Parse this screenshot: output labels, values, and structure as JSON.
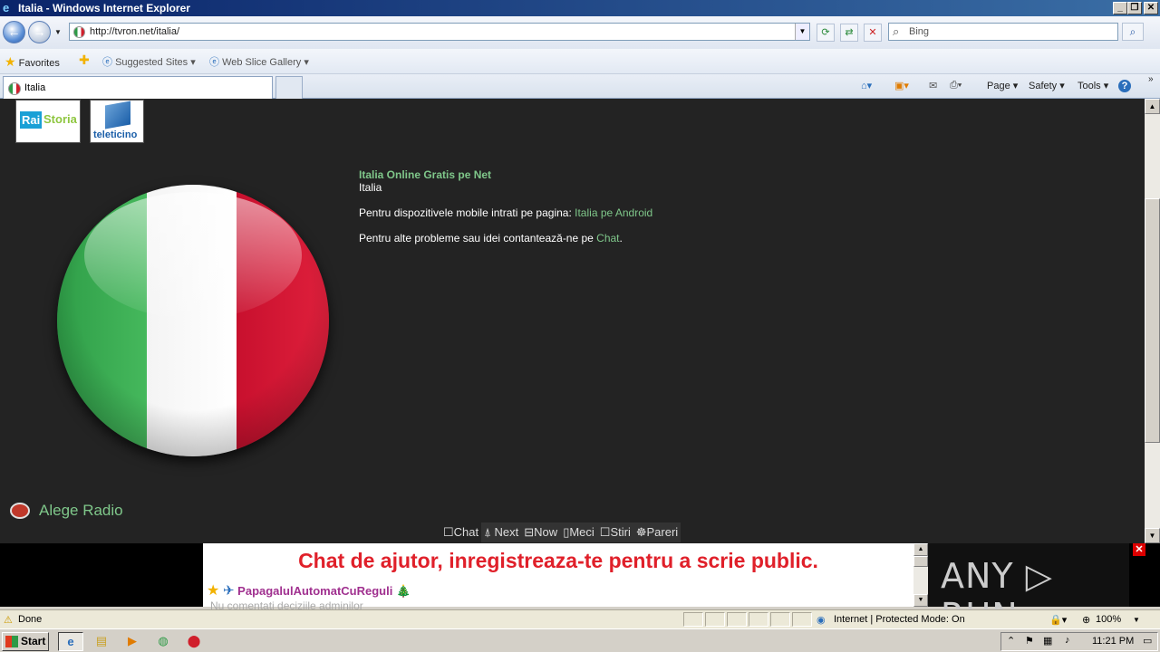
{
  "window": {
    "title": "Italia - Windows Internet Explorer",
    "minimize_label": "_",
    "restore_label": "❐",
    "close_label": "✕"
  },
  "addressbar": {
    "url": "http://tvron.net/italia/",
    "search_placeholder": "Bing"
  },
  "favorites": {
    "favorites_label": "Favorites",
    "suggested_sites": "Suggested Sites ▾",
    "web_slice_gallery": "Web Slice Gallery ▾"
  },
  "tabs": [
    {
      "label": "Italia"
    }
  ],
  "commandbar": {
    "page": "Page ▾",
    "safety": "Safety ▾",
    "tools": "Tools ▾",
    "help": "?"
  },
  "page": {
    "thumbnails": [
      {
        "label_a": "Rai",
        "label_b": "Storia"
      },
      {
        "label": "teleticino"
      }
    ],
    "info": {
      "heading": "Italia Online Gratis pe Net",
      "subtitle": "Italia",
      "mobile_text": "Pentru dispozitivele mobile intrati pe pagina: ",
      "mobile_link": "Italia pe Android",
      "contact_text": "Pentru alte probleme sau idei contantează-ne pe ",
      "contact_link": "Chat",
      "contact_end": "."
    },
    "radio_label": "Alege Radio",
    "bottom_menu": [
      "☐Chat",
      "⍋ Next",
      "⊟Now",
      "▯Meci",
      "☐Stiri",
      "☸Pareri"
    ]
  },
  "chat": {
    "banner": "Chat de ajutor, inregistreaza-te pentru a scrie public.",
    "star": "★",
    "plane": "✈",
    "user": "PapagalulAutomatCuReguli",
    "tree": "🎄",
    "partial_line": "Nu comentati deciziile adminilor",
    "watermark": "ANY ▷ RUN"
  },
  "statusbar": {
    "status": "Done",
    "zone": "Internet | Protected Mode: On",
    "zoom": "100%"
  },
  "taskbar": {
    "start": "Start",
    "clock": "11:21 PM"
  }
}
